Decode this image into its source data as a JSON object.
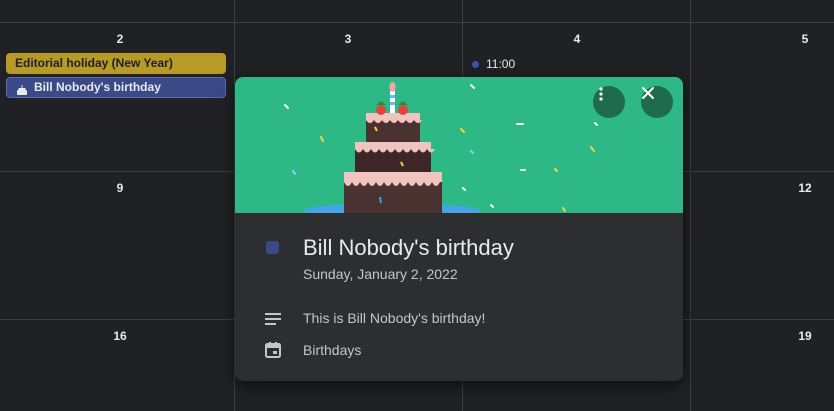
{
  "calendar": {
    "days": [
      {
        "label": "2"
      },
      {
        "label": "3"
      },
      {
        "label": "4"
      },
      {
        "label": "5"
      },
      {
        "label": "9"
      },
      {
        "label": "12"
      },
      {
        "label": "16"
      },
      {
        "label": "19"
      }
    ],
    "events": {
      "holiday": "Editorial holiday (New Year)",
      "birthday": "Bill Nobody's birthday",
      "timed": "11:00"
    }
  },
  "popup": {
    "title": "Bill Nobody's birthday",
    "date": "Sunday, January 2, 2022",
    "description": "This is Bill Nobody's birthday!",
    "calendar_name": "Birthdays",
    "more_icon": "more-vert-icon",
    "close_icon": "close-icon",
    "event_color": "#3b4a87",
    "hero_color": "#2eb886"
  }
}
